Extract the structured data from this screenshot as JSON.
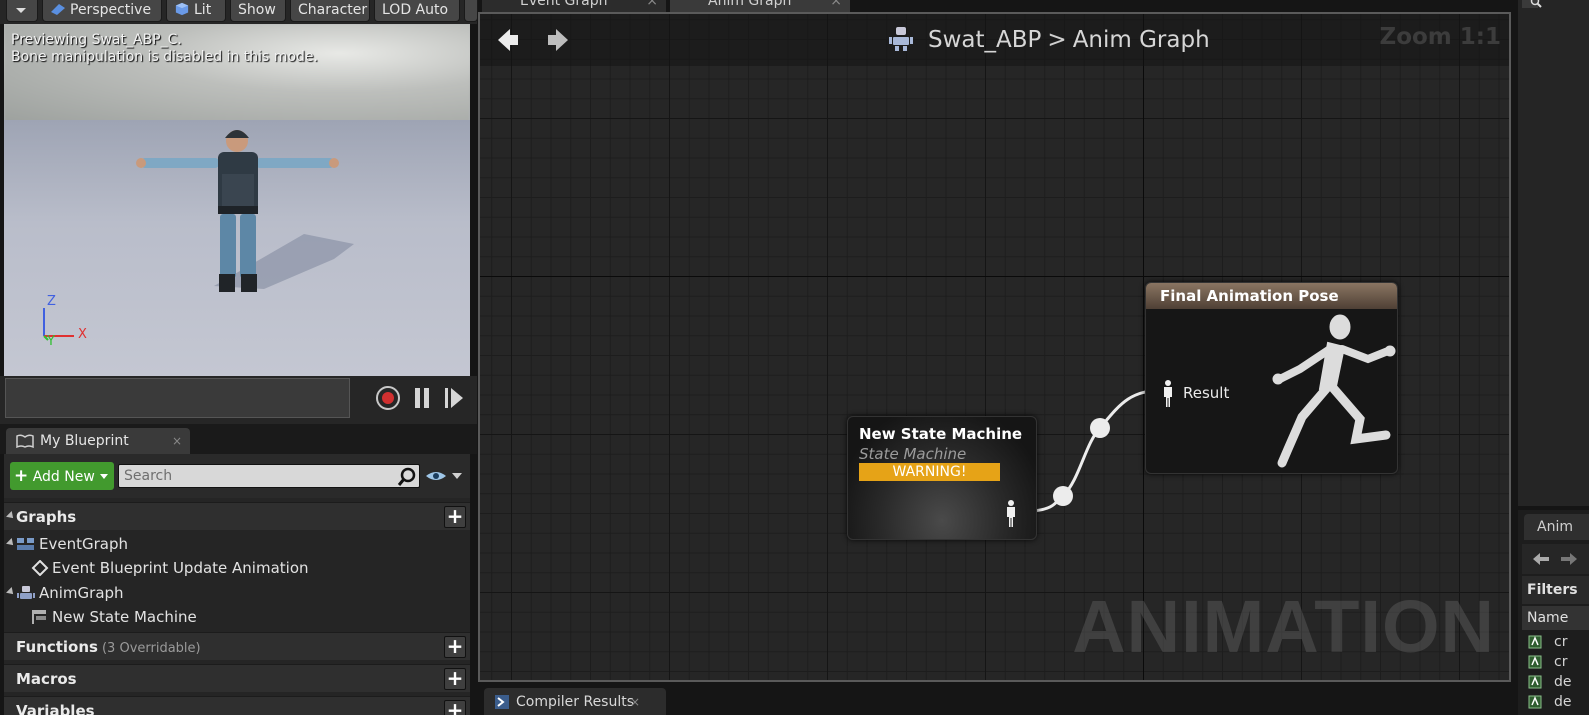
{
  "viewport": {
    "toolbar": {
      "dropdown_label": "",
      "perspective": "Perspective",
      "lit": "Lit",
      "show": "Show",
      "character": "Character",
      "lod": "LOD Auto"
    },
    "overlay_line1": "Previewing Swat_ABP_C.",
    "overlay_line2": "Bone manipulation is disabled in this mode.",
    "axes": {
      "z": "Z",
      "x": "X",
      "y": "Y"
    },
    "colors": {
      "record": "#d03030",
      "axis_x": "#e03030",
      "axis_y": "#30c030",
      "axis_z": "#4060e0"
    }
  },
  "my_blueprint": {
    "tab_label": "My Blueprint",
    "tab_close": "×",
    "add_new": "Add New",
    "search_placeholder": "Search",
    "categories": {
      "graphs": "Graphs",
      "functions": "Functions",
      "functions_sub": "(3 Overridable)",
      "macros": "Macros",
      "variables": "Variables"
    },
    "tree": {
      "event_graph": "EventGraph",
      "event_update": "Event Blueprint Update Animation",
      "anim_graph": "AnimGraph",
      "state_machine": "New State Machine"
    },
    "plus": "+",
    "accent": "#429a2e"
  },
  "graph": {
    "tabs": [
      {
        "label": "Event Graph",
        "close": "×"
      },
      {
        "label": "Anim Graph",
        "close": "×"
      }
    ],
    "breadcrumb": {
      "blueprint": "Swat_ABP",
      "separator": ">",
      "graph": "Anim Graph"
    },
    "zoom": "Zoom 1:1",
    "watermark": "ANIMATION",
    "node_state_machine": {
      "title": "New State Machine",
      "subtitle": "State Machine",
      "warning": "WARNING!",
      "warning_color": "#e6a317"
    },
    "node_final_pose": {
      "title": "Final Animation Pose",
      "pin_label": "Result",
      "header_color": "#8a7562"
    }
  },
  "bottom": {
    "compiler_tab": "Compiler Results",
    "close": "×"
  },
  "right_panel": {
    "tab_label": "Anim",
    "filters": "Filters",
    "name_header": "Name",
    "rows": [
      "cr",
      "cr",
      "de",
      "de"
    ]
  }
}
